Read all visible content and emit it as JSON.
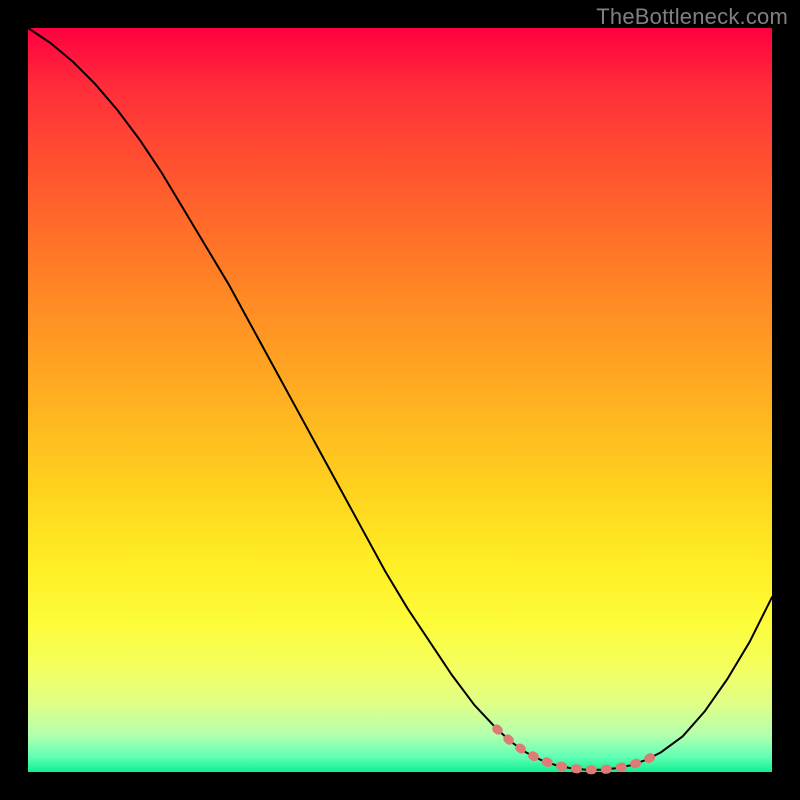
{
  "watermark": "TheBottleneck.com",
  "colors": {
    "frame_bg": "#000000",
    "watermark_text": "#808080",
    "curve_stroke": "#000000",
    "marker_stroke": "#df7b74",
    "gradient_stops": [
      "#ff0040",
      "#ff2d3a",
      "#ff5030",
      "#ff7028",
      "#ff8e24",
      "#ffb021",
      "#ffd21e",
      "#ffee25",
      "#fdfc3a",
      "#f4ff60",
      "#deff88",
      "#b4ffae",
      "#60ffb4",
      "#10f090"
    ]
  },
  "chart_data": {
    "type": "line",
    "title": "",
    "xlabel": "",
    "ylabel": "",
    "xlim": [
      0,
      100
    ],
    "ylim": [
      0,
      100
    ],
    "series": [
      {
        "name": "main_curve",
        "x": [
          0,
          3,
          6,
          9,
          12,
          15,
          18,
          21,
          24,
          27,
          30,
          33,
          36,
          39,
          42,
          45,
          48,
          51,
          54,
          57,
          60,
          63,
          65,
          67,
          69,
          71,
          73,
          75,
          77,
          79,
          81,
          83,
          85,
          88,
          91,
          94,
          97,
          100
        ],
        "y": [
          100,
          98,
          95.5,
          92.5,
          89,
          85,
          80.5,
          75.5,
          70.5,
          65.5,
          60,
          54.5,
          49,
          43.5,
          38,
          32.5,
          27,
          22,
          17.5,
          13,
          9,
          5.8,
          4.0,
          2.6,
          1.6,
          0.9,
          0.5,
          0.3,
          0.3,
          0.5,
          0.9,
          1.6,
          2.6,
          4.8,
          8.2,
          12.5,
          17.5,
          23.5
        ]
      },
      {
        "name": "marker_segment",
        "x": [
          63,
          65,
          67,
          69,
          71,
          73,
          75,
          77,
          79,
          81,
          83,
          85
        ],
        "y": [
          5.8,
          4.0,
          2.6,
          1.6,
          0.9,
          0.5,
          0.3,
          0.3,
          0.5,
          0.9,
          1.6,
          2.6
        ]
      }
    ],
    "annotations": []
  }
}
